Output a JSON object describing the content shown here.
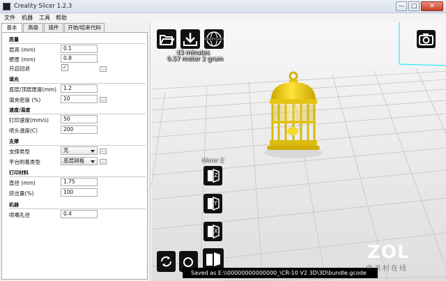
{
  "window": {
    "title": "Creality Slicer 1.2.3",
    "minimize": "—",
    "maximize": "□",
    "close": "✕"
  },
  "menu": [
    "文件",
    "机器",
    "工具",
    "帮助"
  ],
  "tabs": [
    "基本",
    "高级",
    "插件",
    "开始/结束代码"
  ],
  "settings": {
    "quality": {
      "title": "质量",
      "layer_height_label": "层高 (mm)",
      "layer_height": "0.1",
      "shell_label": "壁厚 (mm)",
      "shell": "0.8",
      "retraction_label": "开启回退",
      "retraction_checked": "✓"
    },
    "fill": {
      "title": "填充",
      "top_bottom_label": "底层/顶层厚度(mm)",
      "top_bottom": "1.2",
      "density_label": "填充密度 (%)",
      "density": "10"
    },
    "speed": {
      "title": "速度/温度",
      "print_speed_label": "打印速度(mm/s)",
      "print_speed": "50",
      "nozzle_temp_label": "喷头温度(C)",
      "nozzle_temp": "200"
    },
    "support": {
      "title": "支撑",
      "support_type_label": "支撑类型",
      "support_type": "无",
      "adhesion_label": "平台附着类型",
      "adhesion": "底层网格"
    },
    "filament": {
      "title": "打印材料",
      "diameter_label": "直径 (mm)",
      "diameter": "1.75",
      "flow_label": "挤出量(%)",
      "flow": "100"
    },
    "machine": {
      "title": "机器",
      "nozzle_label": "喷嘴孔径",
      "nozzle": "0.4"
    },
    "dots": "..."
  },
  "viewport": {
    "print_time": "43 minutes",
    "print_material": "0.57 meter 2 gram",
    "cloud_label": "CREALITY CLOUD",
    "mirror_label": "Mirror Z",
    "mirror_z": "Z",
    "mirror_y": "Y",
    "mirror_x": "X",
    "status": "Saved as E:\\\\00000000000000_\\CR-10 V2 3D\\3D\\bundle.gcode"
  },
  "watermark": {
    "brand": "ZOL",
    "cn": "中关村在线"
  },
  "colors": {
    "model": "#f0d21c",
    "shadow": "#c7a90a",
    "grid_bg": "#ececec",
    "grid_line": "#c4c4c4",
    "axis": "#00e5ff"
  }
}
